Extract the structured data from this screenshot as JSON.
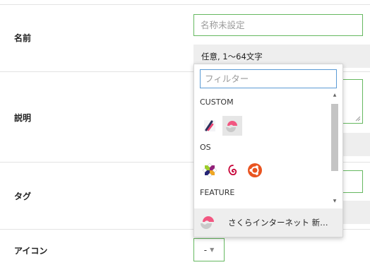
{
  "form": {
    "name": {
      "label": "名前",
      "placeholder": "名称未設定",
      "value": "",
      "hint": "任意, 1〜64文字"
    },
    "description": {
      "label": "説明"
    },
    "tags": {
      "label": "タグ"
    },
    "icon": {
      "label": "アイコン",
      "value": "-",
      "caret": "▼"
    }
  },
  "icon_dropdown": {
    "filter_placeholder": "フィルター",
    "groups": [
      {
        "label": "CUSTOM",
        "options": [
          "custom-pen-icon",
          "sakura-internet-logo-icon"
        ]
      },
      {
        "label": "OS",
        "options": [
          "centos-logo-icon",
          "debian-logo-icon",
          "ubuntu-logo-icon"
        ]
      },
      {
        "label": "FEATURE",
        "options": []
      }
    ],
    "selected": {
      "icon": "sakura-internet-logo-icon",
      "label": "さくらインターネット 新…"
    }
  },
  "colors": {
    "input_border": "#66b860",
    "focus_border": "#5b9bd5",
    "hint_background": "#eeeeee",
    "sakura_pink": "#f25781",
    "ubuntu_orange": "#e95420",
    "debian_red": "#c70036"
  }
}
